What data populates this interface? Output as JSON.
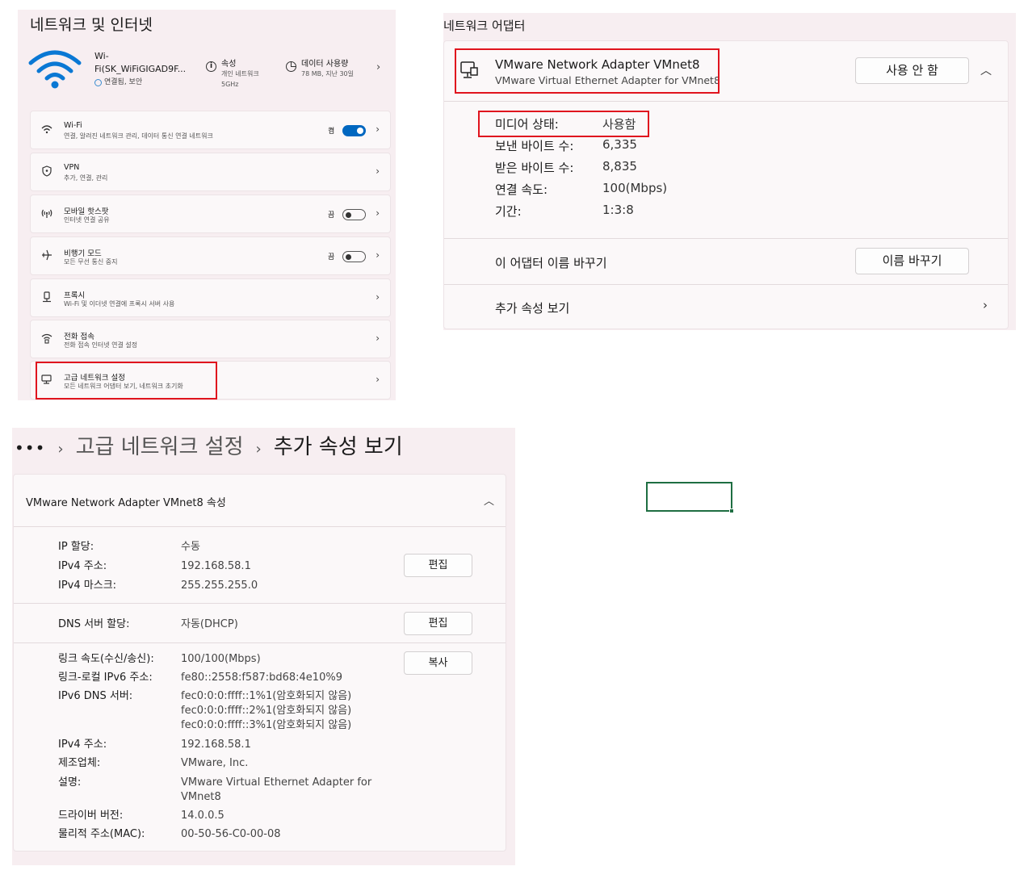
{
  "network_internet": {
    "title": "네트워크 및 인터넷",
    "connection": {
      "name": "Wi-Fi(SK_WiFiGIGAD9F...",
      "status": "연결됨, 보안",
      "properties_label": "속성",
      "properties_sub1": "개인 네트워크",
      "properties_sub2": "5GHz",
      "usage_label": "데이터 사용량",
      "usage_sub": "78 MB, 지난 30일"
    },
    "items": [
      {
        "title": "Wi-Fi",
        "subtitle": "연결, 알려진 네트워크 관리, 데이터 통신 연결 네트워크",
        "toggle_label": "켬",
        "toggle": "on"
      },
      {
        "title": "VPN",
        "subtitle": "추가, 연결, 관리"
      },
      {
        "title": "모바일 핫스팟",
        "subtitle": "인터넷 연결 공유",
        "toggle_label": "끔",
        "toggle": "off"
      },
      {
        "title": "비행기 모드",
        "subtitle": "모든 무선 통신 중지",
        "toggle_label": "끔",
        "toggle": "off"
      },
      {
        "title": "프록시",
        "subtitle": "Wi-Fi 및 이더넷 연결에 프록시 서버 사용"
      },
      {
        "title": "전화 접속",
        "subtitle": "전화 접속 인터넷 연결 설정"
      },
      {
        "title": "고급 네트워크 설정",
        "subtitle": "모든 네트워크 어댑터 보기, 네트워크 초기화"
      }
    ]
  },
  "adapter": {
    "title": "네트워크 어댑터",
    "name": "VMware Network Adapter VMnet8",
    "description": "VMware Virtual Ethernet Adapter for VMnet8",
    "disable_button": "사용 안 함",
    "stats": [
      {
        "label": "미디어 상태:",
        "value": "사용함"
      },
      {
        "label": "보낸 바이트 수:",
        "value": "6,335"
      },
      {
        "label": "받은 바이트 수:",
        "value": "8,835"
      },
      {
        "label": "연결 속도:",
        "value": "100(Mbps)"
      },
      {
        "label": "기간:",
        "value": "1:3:8"
      }
    ],
    "rename_label": "이 어댑터 이름 바꾸기",
    "rename_button": "이름 바꾸기",
    "more_label": "추가 속성 보기"
  },
  "properties": {
    "breadcrumb": {
      "ellipsis": "•••",
      "parent": "고급 네트워크 설정",
      "current": "추가 속성 보기"
    },
    "header": "VMware Network Adapter VMnet8 속성",
    "ip_assignment_label": "IP 할당:",
    "ip_assignment_value": "수동",
    "ipv4_label": "IPv4 주소:",
    "ipv4_value": "192.168.58.1",
    "mask_label": "IPv4 마스크:",
    "mask_value": "255.255.255.0",
    "edit_button": "편집",
    "dns_label": "DNS 서버 할당:",
    "dns_value": "자동(DHCP)",
    "edit_button2": "편집",
    "link_speed_label": "링크 속도(수신/송신):",
    "link_speed_value": "100/100(Mbps)",
    "copy_button": "복사",
    "link_local_label": "링크-로컬 IPv6 주소:",
    "link_local_value": "fe80::2558:f587:bd68:4e10%9",
    "ipv6_dns_label": "IPv6 DNS 서버:",
    "ipv6_dns_values": [
      "fec0:0:0:ffff::1%1(암호화되지 않음)",
      "fec0:0:0:ffff::2%1(암호화되지 않음)",
      "fec0:0:0:ffff::3%1(암호화되지 않음)"
    ],
    "ipv4_label2": "IPv4 주소:",
    "ipv4_value2": "192.168.58.1",
    "manufacturer_label": "제조업체:",
    "manufacturer_value": "VMware, Inc.",
    "description_label": "설명:",
    "description_value1": "VMware Virtual Ethernet Adapter for",
    "description_value2": "VMnet8",
    "driver_label": "드라이버 버전:",
    "driver_value": "14.0.0.5",
    "mac_label": "물리적 주소(MAC):",
    "mac_value": "00-50-56-C0-00-08"
  },
  "colors": {
    "accent": "#0067c0",
    "highlight_box": "#e0141e",
    "excel_selection": "#1e6e42"
  }
}
